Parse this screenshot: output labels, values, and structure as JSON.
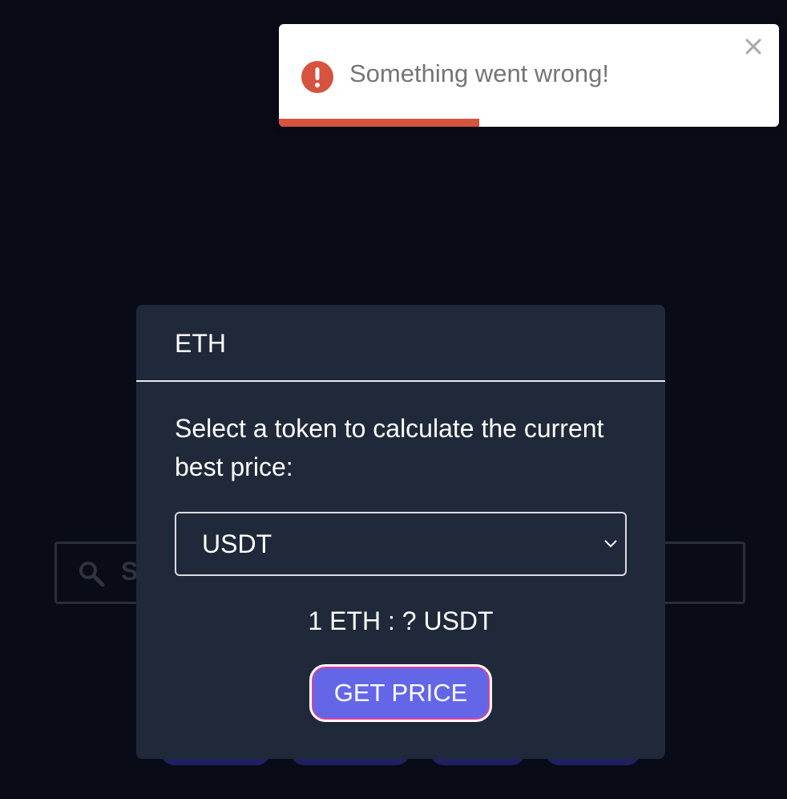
{
  "toast": {
    "message": "Something went wrong!",
    "type": "error",
    "icon": "error-icon",
    "close_icon": "close-icon",
    "progress_fraction": 0.4,
    "accent_color": "#d6533f"
  },
  "background": {
    "search_placeholder_partial": "S",
    "search_icon": "search-icon"
  },
  "modal": {
    "title": "ETH",
    "instruction": "Select a token to calculate the current best price:",
    "select": {
      "selected": "USDT",
      "icon": "chevron-down-icon"
    },
    "price_readout": "1 ETH : ? USDT",
    "button_label": "GET PRICE",
    "button_color": "#6466e8"
  }
}
